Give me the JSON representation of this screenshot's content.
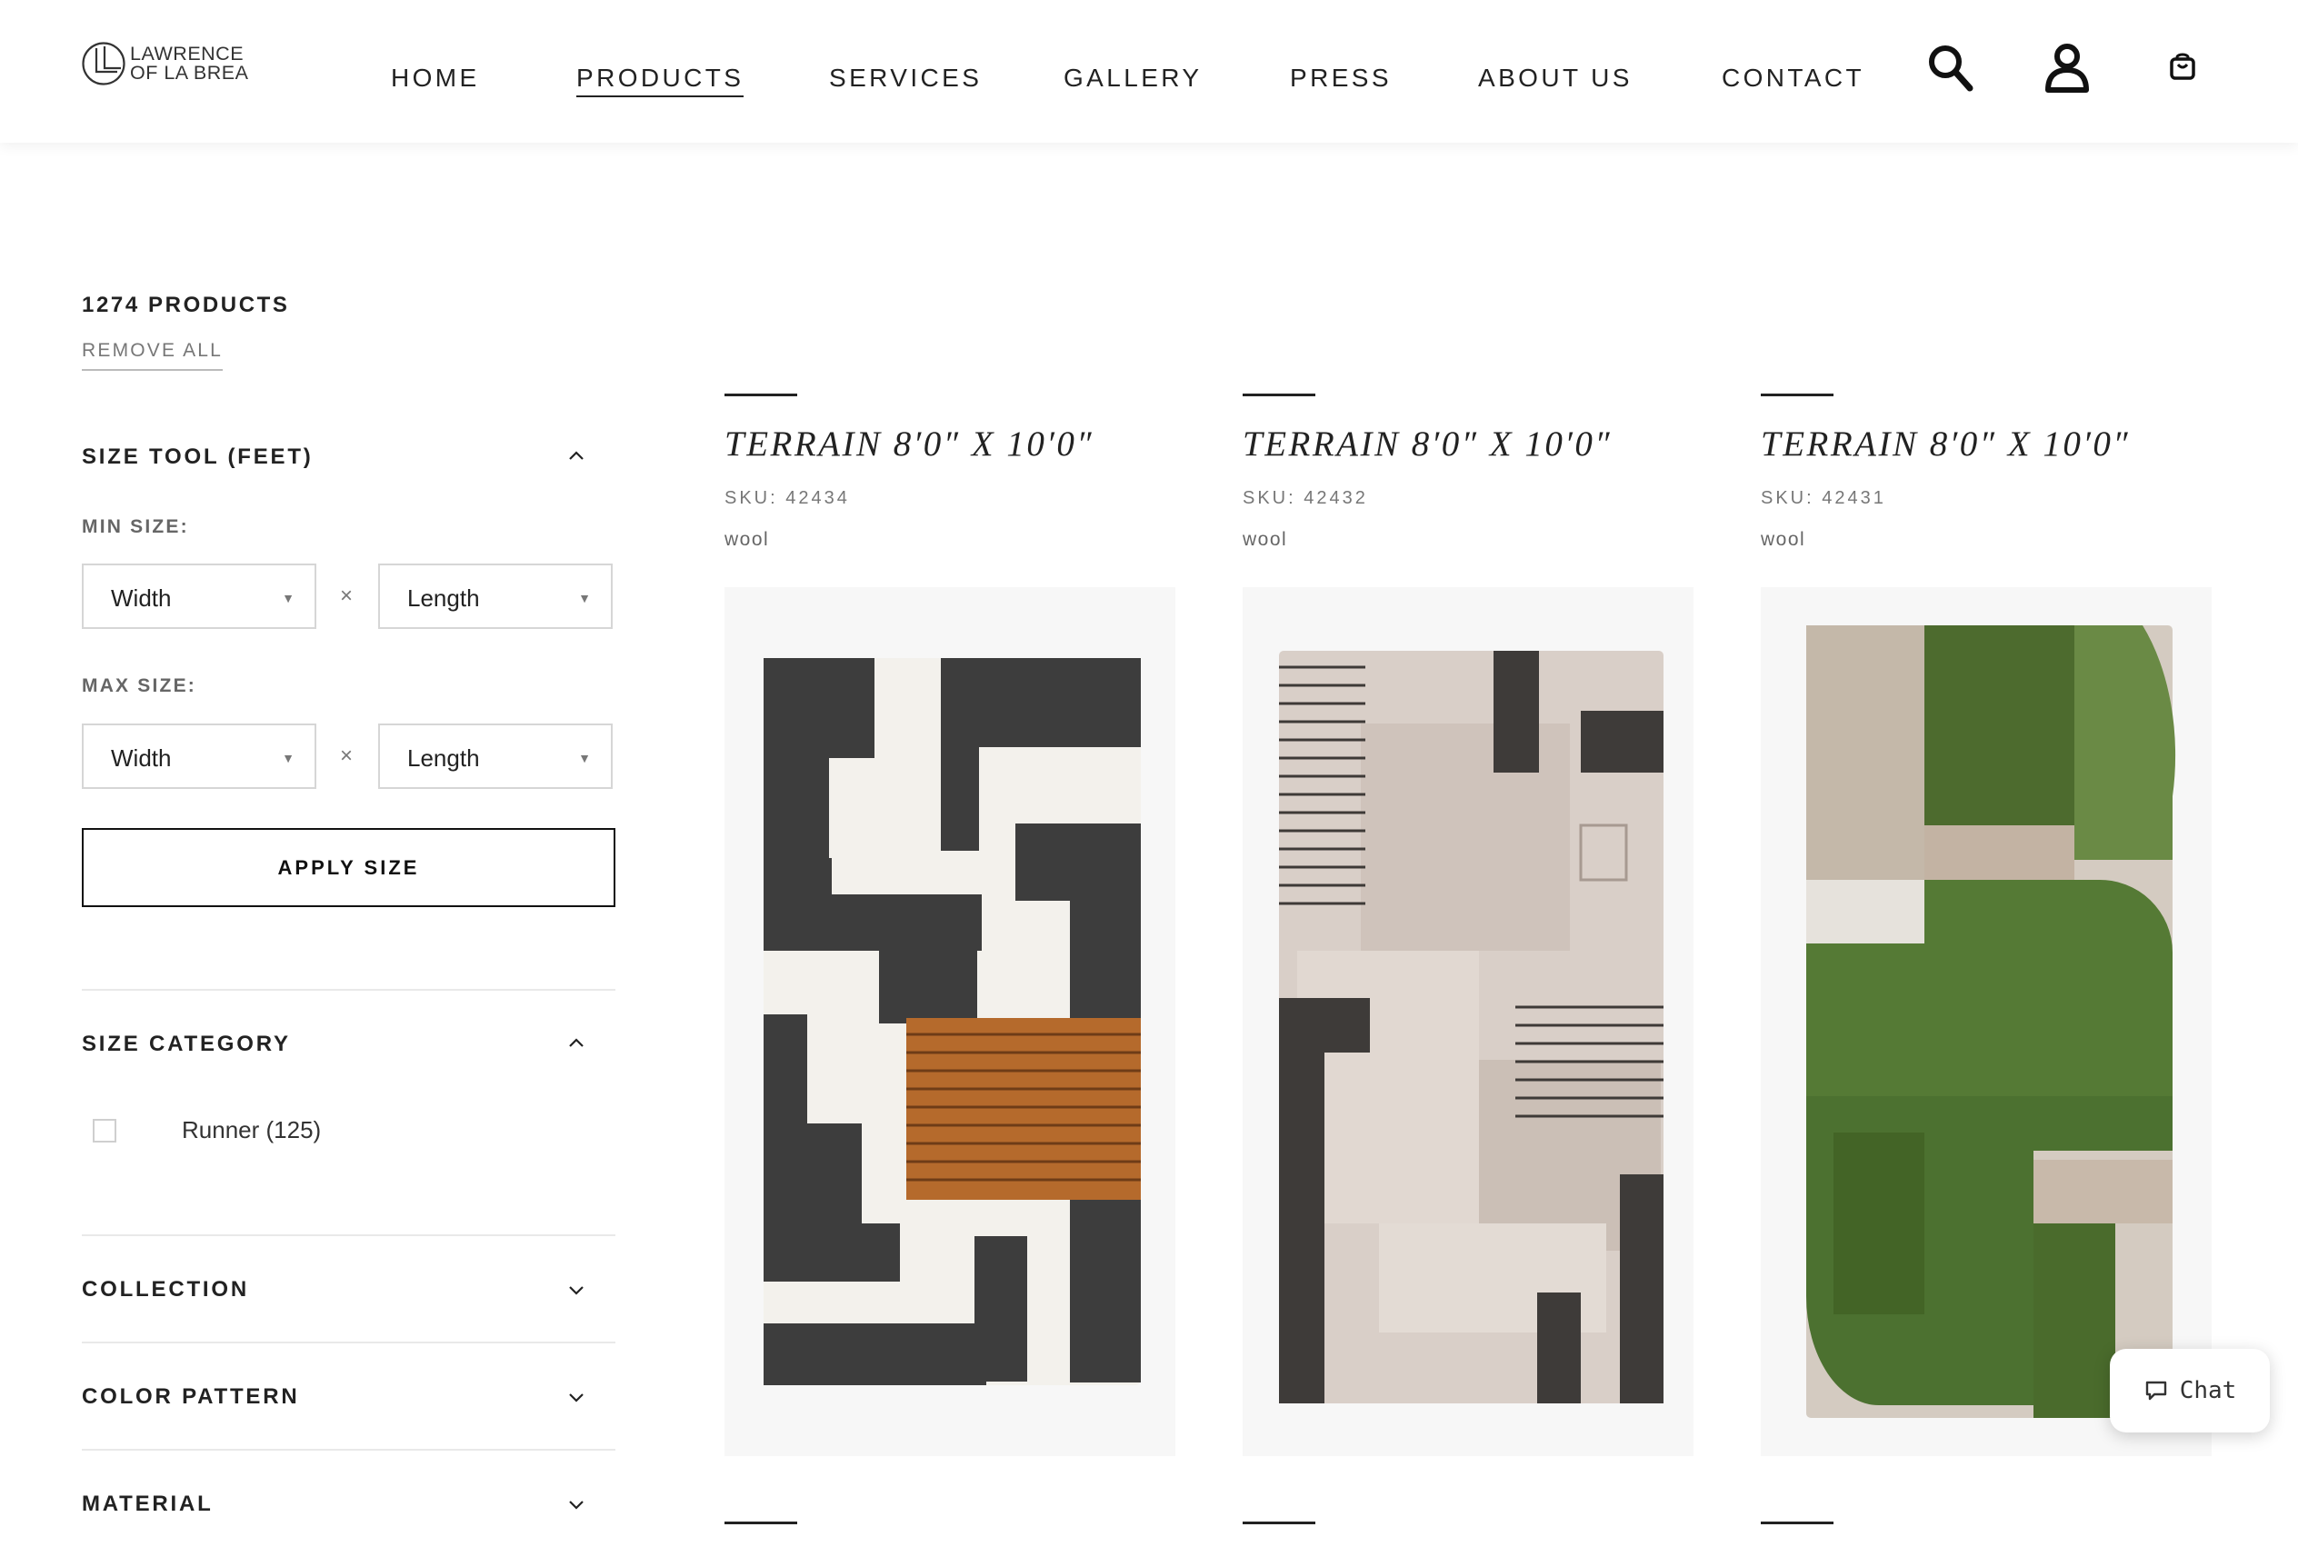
{
  "brand": {
    "line1": "LAWRENCE",
    "line2": "OF LA BREA"
  },
  "nav": {
    "items": [
      {
        "label": "HOME",
        "active": false
      },
      {
        "label": "PRODUCTS",
        "active": true
      },
      {
        "label": "SERVICES",
        "active": false
      },
      {
        "label": "GALLERY",
        "active": false
      },
      {
        "label": "PRESS",
        "active": false
      },
      {
        "label": "ABOUT US",
        "active": false
      },
      {
        "label": "CONTACT",
        "active": false
      }
    ],
    "icons": [
      "search-icon",
      "account-icon",
      "cart-icon"
    ]
  },
  "filters": {
    "count": "1274 PRODUCTS",
    "remove_all": "REMOVE ALL",
    "size_tool": {
      "title": "SIZE TOOL (FEET)",
      "min_label": "MIN SIZE:",
      "max_label": "MAX SIZE:",
      "width": "Width",
      "length": "Length",
      "times": "×",
      "apply": "APPLY SIZE"
    },
    "size_category": {
      "title": "SIZE CATEGORY",
      "option": "Runner (125)",
      "checked": false
    },
    "collection": "COLLECTION",
    "color_pattern": "COLOR PATTERN",
    "material": "MATERIAL"
  },
  "products": [
    {
      "title": "TERRAIN 8′0″ X 10′0″",
      "sku": "SKU: 42434",
      "material": "wool",
      "palette": "black-white-rust"
    },
    {
      "title": "TERRAIN 8′0″ X 10′0″",
      "sku": "SKU: 42432",
      "material": "wool",
      "palette": "beige-charcoal"
    },
    {
      "title": "TERRAIN 8′0″ X 10′0″",
      "sku": "SKU: 42431",
      "material": "wool",
      "palette": "green-sand"
    }
  ],
  "chat": {
    "label": "Chat"
  },
  "colors": {
    "text": "#222222",
    "muted": "#777777",
    "divider": "#e9e9e9"
  }
}
